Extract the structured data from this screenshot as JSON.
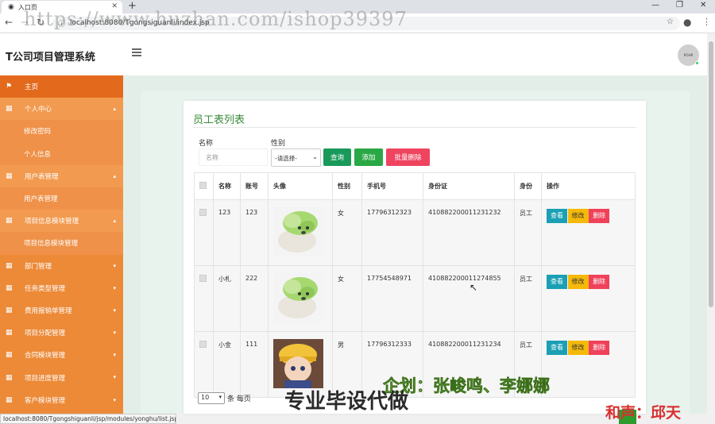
{
  "browser": {
    "tab_title": "入口页",
    "url": "localhost:8080/Tgongsiguanli/index.jsp",
    "watermark": "https://www.huzhan.com/ishop39397",
    "status_url": "localhost:8080/Tgongshiguanli/jsp/modules/yonghu/list.jsp"
  },
  "header": {
    "app_title": "T公司项目管理系统",
    "avatar_text": "ROHR"
  },
  "sidebar": {
    "items": [
      {
        "label": "主页",
        "kind": "home"
      },
      {
        "label": "个人中心",
        "kind": "group",
        "open": true
      },
      {
        "label": "修改密码",
        "kind": "sub"
      },
      {
        "label": "个人信息",
        "kind": "sub"
      },
      {
        "label": "用户表管理",
        "kind": "group",
        "open": true
      },
      {
        "label": "用户表管理",
        "kind": "sub"
      },
      {
        "label": "项目信息模块管理",
        "kind": "group",
        "open": true
      },
      {
        "label": "项目信息模块管理",
        "kind": "sub"
      },
      {
        "label": "部门管理",
        "kind": "group"
      },
      {
        "label": "任务类型管理",
        "kind": "group"
      },
      {
        "label": "费用报销单管理",
        "kind": "group"
      },
      {
        "label": "项目分配管理",
        "kind": "group"
      },
      {
        "label": "合同模块管理",
        "kind": "group"
      },
      {
        "label": "项目进度管理",
        "kind": "group"
      },
      {
        "label": "客户模块管理",
        "kind": "group"
      }
    ]
  },
  "content": {
    "title": "员工表列表",
    "search": {
      "name_label": "名称",
      "name_placeholder": "名称",
      "sex_label": "性别",
      "sex_selected": "-请选择-"
    },
    "buttons": {
      "query": "查询",
      "add": "添加",
      "batch_delete": "批量删除"
    },
    "colors": {
      "query": "#1a9a5a",
      "add": "#2aa845",
      "batch_delete": "#ef4460"
    },
    "table": {
      "headers": [
        "名称",
        "账号",
        "头像",
        "性别",
        "手机号",
        "身份证",
        "身份",
        "操作"
      ],
      "rows": [
        {
          "name": "123",
          "account": "123",
          "avatar": "cabbage-dog",
          "sex": "女",
          "phone": "17796312323",
          "idcard": "410882200011231232",
          "role": "员工"
        },
        {
          "name": "小札",
          "account": "222",
          "avatar": "cabbage-dog",
          "sex": "女",
          "phone": "17754548971",
          "idcard": "410882200011274855",
          "role": "员工"
        },
        {
          "name": "小金",
          "account": "111",
          "avatar": "anime-boy",
          "sex": "男",
          "phone": "17796312333",
          "idcard": "410882200011231234",
          "role": "员工"
        }
      ],
      "actions": {
        "view": "查看",
        "edit": "修改",
        "delete": "删除"
      }
    },
    "pager": {
      "page_size": "10",
      "suffix": "条 每页"
    }
  },
  "overlay": {
    "planner": "企划：张峻鸣、李娜娜",
    "main": "专业毕设代做",
    "voice": "和声：邱天"
  }
}
